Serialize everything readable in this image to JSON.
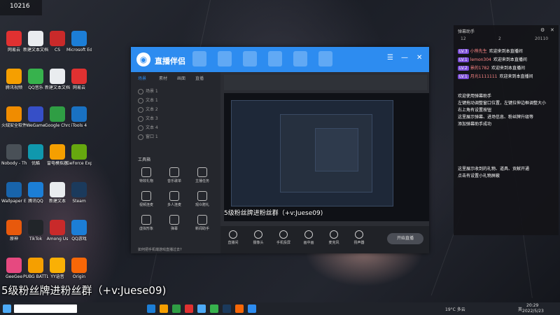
{
  "overlay": {
    "watermark": "5级粉丝牌进粉丝群（+v:Juese09)",
    "corner_count": "10216"
  },
  "desktop": {
    "icons": [
      {
        "label": "网易云",
        "color": "#e03131"
      },
      {
        "label": "新建文本文档",
        "color": "#e9ecef"
      },
      {
        "label": "CS",
        "color": "#c92a2a"
      },
      {
        "label": "Microsoft Edge",
        "color": "#1c7ed6"
      },
      {
        "label": "腾讯视频",
        "color": "#f59f00"
      },
      {
        "label": "QQ音乐",
        "color": "#37b24d"
      },
      {
        "label": "新建文本文档",
        "color": "#e9ecef"
      },
      {
        "label": "网易云",
        "color": "#e03131"
      },
      {
        "label": "火绒安全软件",
        "color": "#f08c00"
      },
      {
        "label": "WeGame",
        "color": "#364fc7"
      },
      {
        "label": "Google Chrome",
        "color": "#2f9e44"
      },
      {
        "label": "iTools 4",
        "color": "#1971c2"
      },
      {
        "label": "Nobody - The Turna...",
        "color": "#495057"
      },
      {
        "label": "优酷",
        "color": "#1098ad"
      },
      {
        "label": "雷电模拟器",
        "color": "#f59f00"
      },
      {
        "label": "GeForce Experience",
        "color": "#66a80f"
      },
      {
        "label": "Wallpaper Engine",
        "color": "#1864ab"
      },
      {
        "label": "腾讯QQ",
        "color": "#1c7ed6"
      },
      {
        "label": "新建文本",
        "color": "#e9ecef"
      },
      {
        "label": "Steam",
        "color": "#1b3a5c"
      },
      {
        "label": "原神",
        "color": "#e8590c"
      },
      {
        "label": "TikTok",
        "color": "#212529"
      },
      {
        "label": "Among Us",
        "color": "#c92a2a"
      },
      {
        "label": "QQ游戏",
        "color": "#1c7ed6"
      },
      {
        "label": "GeeGee",
        "color": "#e64980"
      },
      {
        "label": "PUBG BATTLEGR...",
        "color": "#f59f00"
      },
      {
        "label": "YY语音",
        "color": "#fab005"
      },
      {
        "label": "Origin",
        "color": "#f76707"
      }
    ]
  },
  "app": {
    "name": "直播伴侣",
    "sidebar_tabs": [
      "场景",
      "素材",
      "画面",
      "直播"
    ],
    "scenes": [
      "场景 1",
      "文本 1",
      "文本 2",
      "文本 3",
      "文本 4",
      "窗口 1"
    ],
    "toolbox_title": "工具箱",
    "tools": [
      "特效礼物",
      "音乐歌单",
      "主播任务",
      "视频连麦",
      "多人连麦",
      "观众赠礼",
      "虚拟形象",
      "弹幕",
      "新闻助手"
    ],
    "tip": "如何把手机端游戏直播过去?",
    "preview_caption": "5级粉丝牌进粉丝群（+v:Juese09)",
    "bottom": [
      "直播间",
      "摄像头",
      "手机投屏",
      "画中画",
      "麦克风",
      "扬声器"
    ],
    "start_button": "开始直播",
    "stats": [
      "CPU:30%",
      "FPS:60",
      "0KB/s"
    ]
  },
  "chat": {
    "title": "弹幕助手",
    "stats": [
      "12",
      "2",
      "20110"
    ],
    "messages": [
      {
        "badge": "LV.3",
        "name": "小熊先生",
        "text": "欢迎来到本直播间",
        "color": "#ff8787"
      },
      {
        "badge": "LV.1",
        "name": "lemon304",
        "text": "欢迎来到本直播间",
        "color": "#ff8787"
      },
      {
        "badge": "LV.2",
        "name": "景的1782",
        "text": "欢迎来到本直播间",
        "color": "#ff8787"
      },
      {
        "badge": "LV.1",
        "name": "月光1111111",
        "text": "欢迎来到本直播间",
        "color": "#ff8787"
      }
    ],
    "notice": [
      "欢迎使用弹幕助手",
      "左键拖动调整窗口位置，左键拉伸边框调整大小",
      "右上角有设置按钮",
      "这里展示弹幕、进场信息、粉丝牌升级等",
      "添加弹幕助手成功"
    ],
    "notice2": [
      "这里展示收到的礼物、道具、贡献开通",
      "点击有设置小礼物屏蔽"
    ]
  },
  "taskbar": {
    "clock_time": "20:29",
    "clock_date": "2022/5/23",
    "weather": "19°C 多云",
    "lang": "英"
  }
}
